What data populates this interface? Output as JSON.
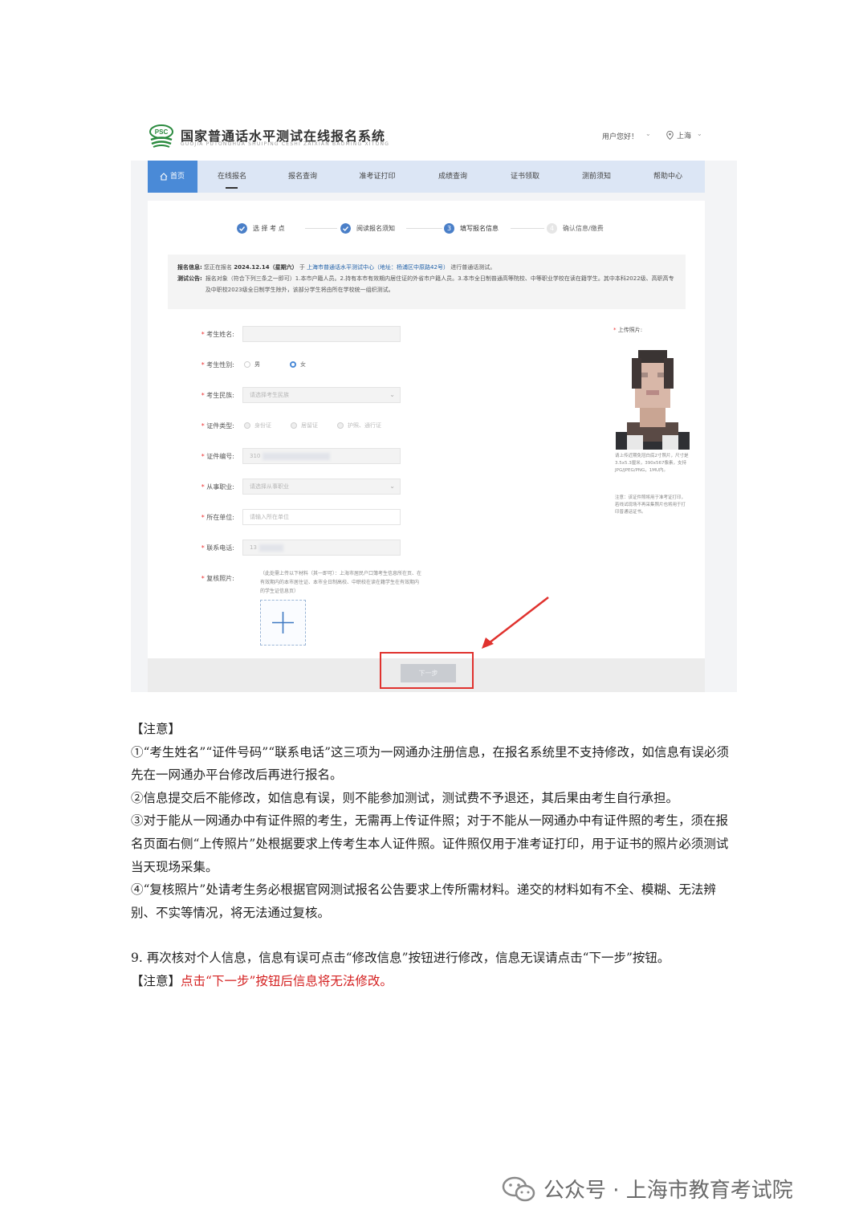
{
  "header": {
    "logo_badge": "PSC",
    "title": "国家普通话水平测试在线报名系统",
    "subtitle": "GUOJIA PUTONGHUA SHUIPING CESHI ZAIXIAN BAOMING XITONG",
    "greeting": "用户您好！",
    "location": "上海"
  },
  "nav": {
    "items": [
      "首页",
      "在线报名",
      "报名查询",
      "准考证打印",
      "成绩查询",
      "证书领取",
      "测前须知",
      "帮助中心"
    ]
  },
  "steps": [
    "选 择 考 点",
    "阅读报名须知",
    "填写报名信息",
    "确认信息/缴费"
  ],
  "step_numbers": [
    "3",
    "4"
  ],
  "notice": {
    "info_label": "报名信息:",
    "info_text_1": "您正在报名",
    "info_date": "2024.12.14（星期六）",
    "info_text_2": "于",
    "info_center": "上海市普通话水平测试中心（地址：杨浦区中原路42号）",
    "info_text_3": "进行普通话测试。",
    "announce_label": "测试公告:",
    "announce_text": "报名对象（符合下列三条之一即可）1.本市户籍人员。2.持有本市有效期内居住证的外省市户籍人员。3.本市全日制普通高等院校、中等职业学校在读在籍学生。其中本科2022级、高职高专及中职校2023级全日制学生除外，该部分学生将由所在学校统一组织测试。"
  },
  "form": {
    "name_label": "考生姓名:",
    "gender_label": "考生性别:",
    "gender_male": "男",
    "gender_female": "女",
    "ethnicity_label": "考生民族:",
    "ethnicity_placeholder": "请选择考生民族",
    "idtype_label": "证件类型:",
    "idtype_options": [
      "身份证",
      "居留证",
      "护照、通行证"
    ],
    "idno_label": "证件编号:",
    "idno_value": "310",
    "occupation_label": "从事职业:",
    "occupation_placeholder": "请选择从事职业",
    "unit_label": "所在单位:",
    "unit_placeholder": "请输入所在单位",
    "phone_label": "联系电话:",
    "phone_value": "13",
    "review_label": "复核照片:",
    "review_note": "（此处需上传以下材料（其一即可）：上海市居民户口簿考生信息所在页、在有效期内的本市居住证、本市全日制高校、中职校在读在籍学生在有效期内的学生证信息页）",
    "photo_label": "上传照片:",
    "photo_note_1": "请上传近期免冠白底2寸照片，尺寸是3.5x5.3厘米，390x567像素，支持JPG/JPEG/PNG，1MU内。",
    "photo_note_2": "注意：该证件照将用于准考证打印，若线试现场不再采集照片也将用于打印普通话证书。",
    "next_button": "下一步"
  },
  "doc": {
    "note_title": "【注意】",
    "p1": "①“考生姓名”“证件号码”“联系电话”这三项为一网通办注册信息，在报名系统里不支持修改，如信息有误必须先在一网通办平台修改后再进行报名。",
    "p2": "②信息提交后不能修改，如信息有误，则不能参加测试，测试费不予退还，其后果由考生自行承担。",
    "p3": "③对于能从一网通办中有证件照的考生，无需再上传证件照；对于不能从一网通办中有证件照的考生，须在报名页面右侧“上传照片”处根据要求上传考生本人证件照。证件照仅用于准考证打印，用于证书的照片必须测试当天现场采集。",
    "p4": "④“复核照片”处请考生务必根据官网测试报名公告要求上传所需材料。递交的材料如有不全、模糊、无法辨别、不实等情况，将无法通过复核。",
    "p5": "9. 再次核对个人信息，信息有误可点击“修改信息”按钮进行修改，信息无误请点击“下一步”按钮。",
    "note2_title": "【注意】",
    "note2_text": "点击“下一步”按钮后信息将无法修改。"
  },
  "watermark": "公众号 · 上海市教育考试院",
  "colors": {
    "nav_active": "#4a8ad7",
    "nav_bg": "#dce6f5",
    "highlight": "#e0322e",
    "warning_text": "#d42020",
    "logo_green": "#2a8a3e"
  }
}
